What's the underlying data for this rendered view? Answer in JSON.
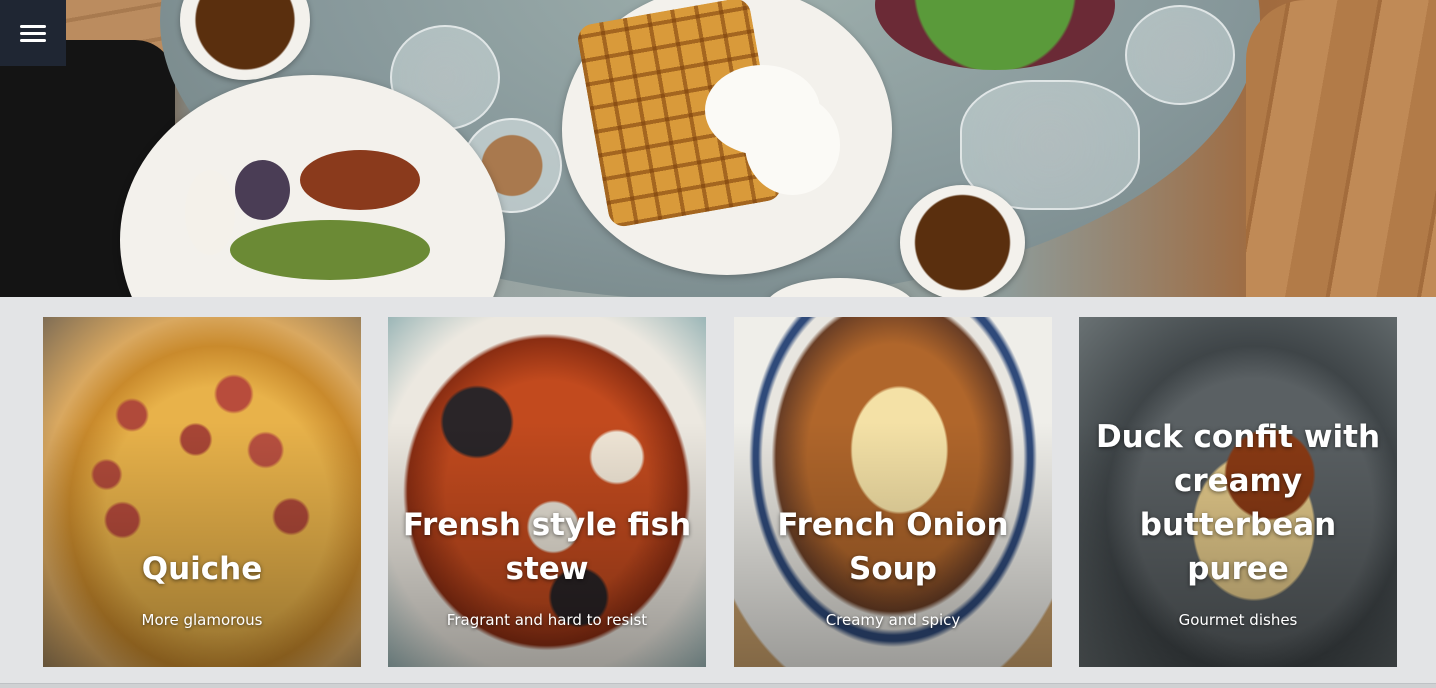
{
  "header": {
    "menu_icon": "hamburger-menu-icon",
    "hero_image": "top-down-breakfast-table"
  },
  "cards": [
    {
      "title": "Quiche",
      "subtitle": "More glamorous",
      "image": "quiche-photo"
    },
    {
      "title": "Frensh style fish stew",
      "subtitle": "Fragrant and hard to resist",
      "image": "fish-stew-photo"
    },
    {
      "title": "French Onion Soup",
      "subtitle": "Creamy and spicy",
      "image": "onion-soup-photo"
    },
    {
      "title": "Duck confit with creamy butterbean puree",
      "subtitle": "Gourmet dishes",
      "image": "duck-confit-photo"
    }
  ],
  "colors": {
    "menu_bg": "#1f2633",
    "page_bg": "#e3e4e6",
    "card_text": "#ffffff"
  }
}
